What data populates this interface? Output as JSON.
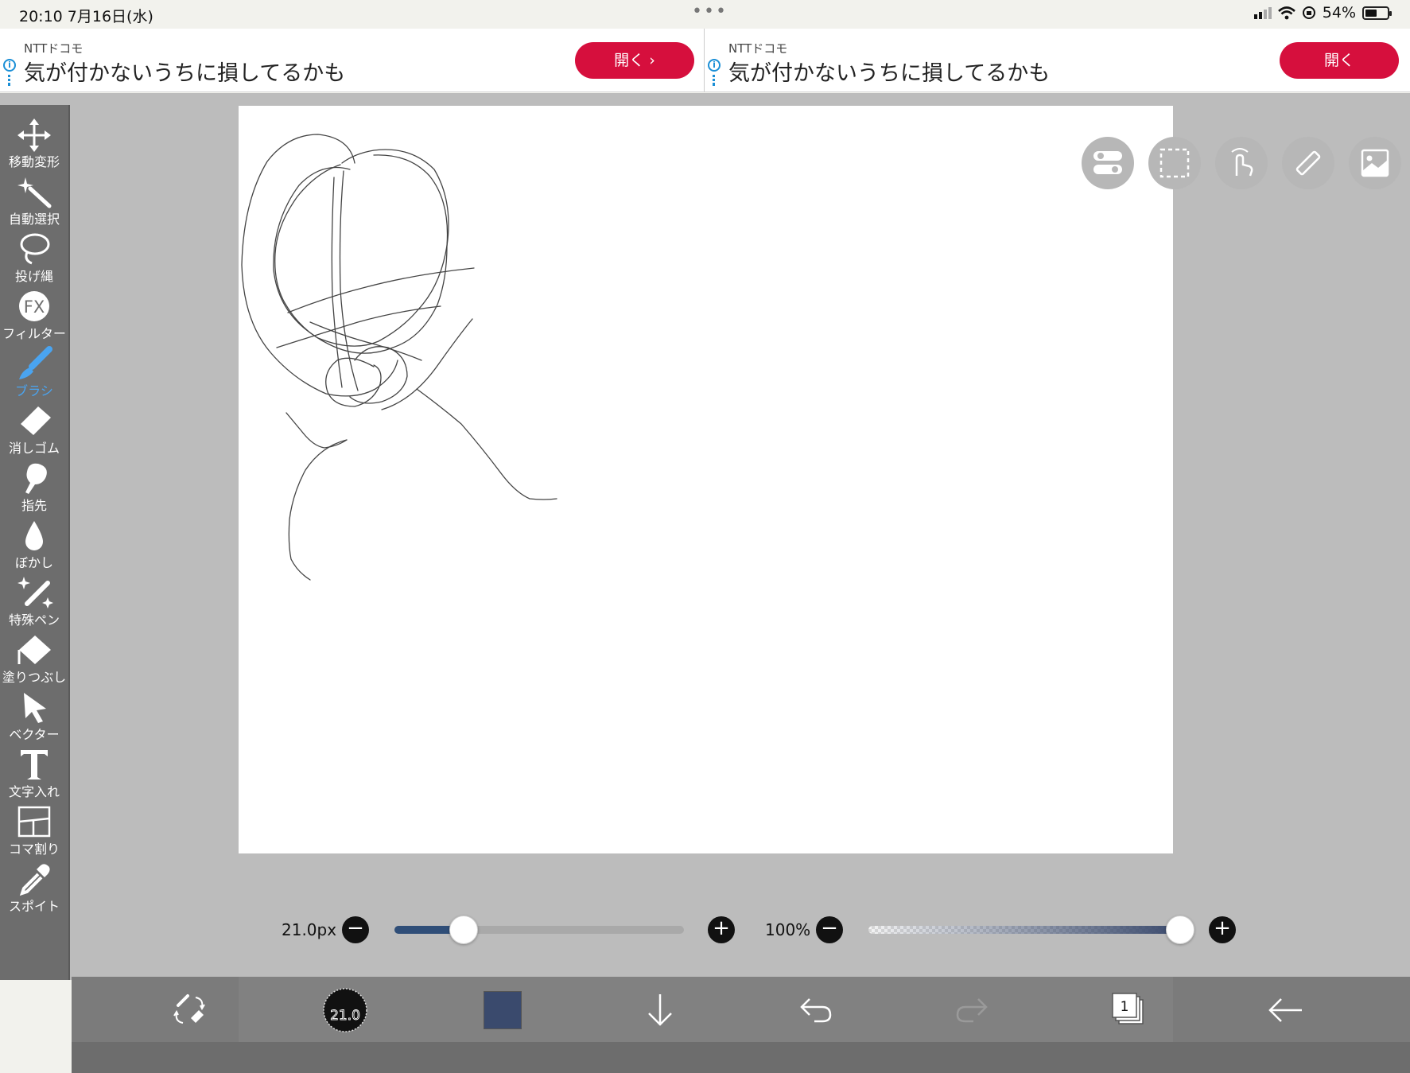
{
  "status_bar": {
    "time": "20:10   7月16日(水)",
    "battery": "54%",
    "battery_level": 0.54
  },
  "ads": [
    {
      "sponsor": "NTTドコモ",
      "headline": "気が付かないうちに損してるかも",
      "cta": "開く ›"
    },
    {
      "sponsor": "NTTドコモ",
      "headline": "気が付かないうちに損してるかも",
      "cta": "開く"
    }
  ],
  "tools": [
    {
      "label": "移動変形",
      "icon": "move-transform-icon"
    },
    {
      "label": "自動選択",
      "icon": "magic-wand-icon"
    },
    {
      "label": "投げ縄",
      "icon": "lasso-icon"
    },
    {
      "label": "フィルター",
      "icon": "fx-filter-icon"
    },
    {
      "label": "ブラシ",
      "icon": "brush-icon",
      "active": true
    },
    {
      "label": "消しゴム",
      "icon": "eraser-icon"
    },
    {
      "label": "指先",
      "icon": "finger-smudge-icon"
    },
    {
      "label": "ぼかし",
      "icon": "blur-drop-icon"
    },
    {
      "label": "特殊ペン",
      "icon": "special-pen-icon"
    },
    {
      "label": "塗りつぶし",
      "icon": "fill-bucket-icon"
    },
    {
      "label": "ベクター",
      "icon": "vector-arrow-icon"
    },
    {
      "label": "文字入れ",
      "icon": "text-icon"
    },
    {
      "label": "コマ割り",
      "icon": "panel-frame-icon"
    },
    {
      "label": "スポイト",
      "icon": "eyedropper-icon"
    }
  ],
  "quick_buttons": [
    "toggle-settings-icon",
    "selection-rect-icon",
    "touch-gesture-icon",
    "ruler-icon",
    "image-icon"
  ],
  "brush": {
    "size_label": "21.0px",
    "size_level": 0.24,
    "opacity_label": "100%",
    "opacity_level": 1.0,
    "preview_size": "21.0",
    "color": "#3a4a6d"
  },
  "bottom_bar": {
    "layer_count": "1"
  }
}
